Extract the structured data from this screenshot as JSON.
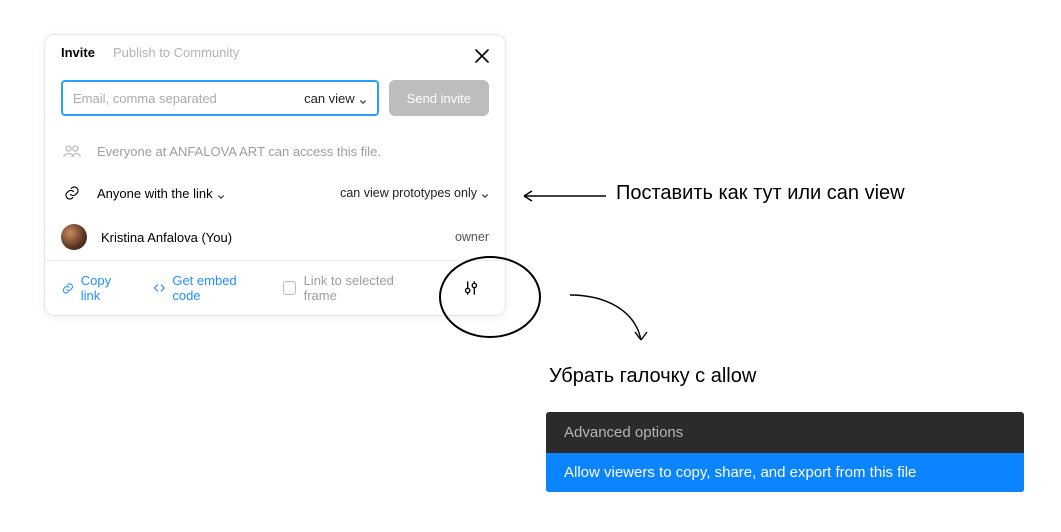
{
  "dialog": {
    "tabs": {
      "invite": "Invite",
      "publish": "Publish to Community"
    },
    "email_placeholder": "Email, comma separated",
    "perm_select": "can view",
    "send_button": "Send invite",
    "org_access": "Everyone at ANFALOVA ART can access this file.",
    "link_access": {
      "label": "Anyone with the link",
      "permission": "can view prototypes only"
    },
    "owner_row": {
      "name": "Kristina Anfalova (You)",
      "role": "owner"
    },
    "footer": {
      "copy_link": "Copy link",
      "get_embed": "Get embed code",
      "link_frame": "Link to selected frame"
    }
  },
  "annotations": {
    "note1": "Поставить как тут или can view",
    "note2": "Убрать галочку с allow"
  },
  "advanced_menu": {
    "header": "Advanced options",
    "item1": "Allow viewers to copy, share, and export from this file"
  }
}
